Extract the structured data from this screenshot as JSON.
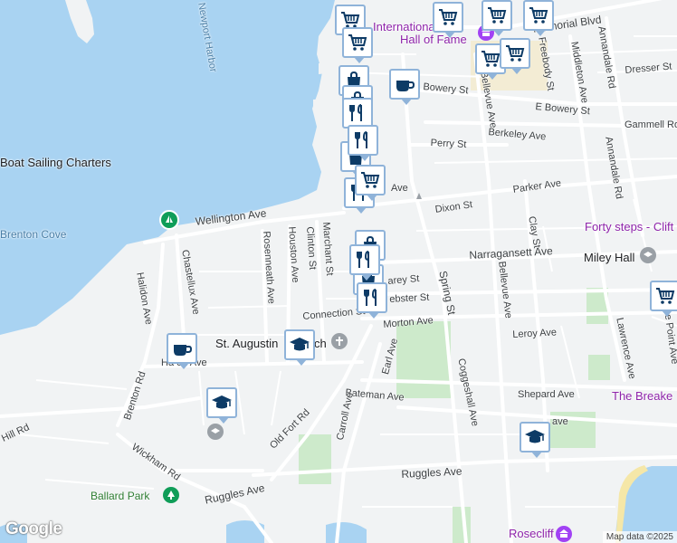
{
  "streets": {
    "memorial_blvd": "Memorial Blvd",
    "dresser_st": "Dresser St",
    "annandale_rd": "Annandale Rd",
    "middleton_ave": "Middleton Ave",
    "freebody_st": "Freebody St",
    "bellevue_ave": "Bellevue Ave",
    "bowery_st": "Bowery St",
    "e_bowery_st": "E Bowery St",
    "berkeley_ave": "Berkeley Ave",
    "gammell_rd": "Gammell Rd",
    "perry_st": "Perry St",
    "ave_fragment": "Ave",
    "parker_ave": "Parker Ave",
    "dixon_st": "Dixon St",
    "clay_st": "Clay St",
    "wellington_ave": "Wellington Ave",
    "narragansett_ave": "Narragansett Ave",
    "chastellux_ave": "Chastellux Ave",
    "rosenneath_ave": "Rosenneath Ave",
    "houston_ave": "Houston Ave",
    "clinton_st": "Clinton St",
    "marchant_st": "Marchant St",
    "spring_st": "Spring St",
    "lawrence_ave": "Lawrence Ave",
    "the_point_ave": "che Point Ave",
    "webster_st": "ebster St",
    "carey_st": "arey St",
    "connection_st": "Connection St",
    "morton_ave": "Morton Ave",
    "leroy_ave": "Leroy Ave",
    "halidon_ave": "Halidon Ave",
    "harrison_ave": "Ha     on Ave",
    "earl_ave": "Earl Ave",
    "coggeshall_ave": "Coggeshall Ave",
    "shepard_ave": "Shepard Ave",
    "brenton_rd": "Brenton Rd",
    "old_fort_rd": "Old Fort Rd",
    "bateman_ave": "Bateman Ave",
    "carroll_ave": "Carroll Ave",
    "wickham_rd": "Wickham Rd",
    "ruggles_ave_1": "Ruggles Ave",
    "ruggles_ave_2": "Ruggles Ave",
    "hill_rd": "Hill Rd",
    "ave_fragment_2": "ave"
  },
  "places": {
    "hall_of_fame_1": "International",
    "hall_of_fame_2": "Hall of Fame",
    "newport_harbor": "Newport Harbor",
    "sailing_charters": "Boat Sailing Charters",
    "brenton_cove": "Brenton Cove",
    "forty_steps": "Forty steps - Clift",
    "miley_hall": "Miley Hall",
    "st_augustin": "St. Augustin",
    "st_augustin_end": "ch",
    "the_breakers": "The Breake",
    "ballard_park": "Ballard Park",
    "rosecliff": "Rosecliff"
  },
  "marker_icons": {
    "shop": "shopping-cart-icon",
    "cafe": "coffee-cup-icon",
    "restaurant": "fork-knife-icon",
    "bag": "shopping-bag-icon",
    "school": "graduation-cap-icon"
  },
  "colors": {
    "water": "#a9d3f2",
    "land": "#f1f3f4",
    "park": "#cdeacb",
    "road": "#ffffff",
    "marker_border": "#8fb3d9",
    "icon": "#0d3b66",
    "poi_red": "#c5221f",
    "poi_purple": "#8e24aa"
  },
  "attribution": {
    "logo": "Google",
    "text": "Map data ©2025"
  }
}
